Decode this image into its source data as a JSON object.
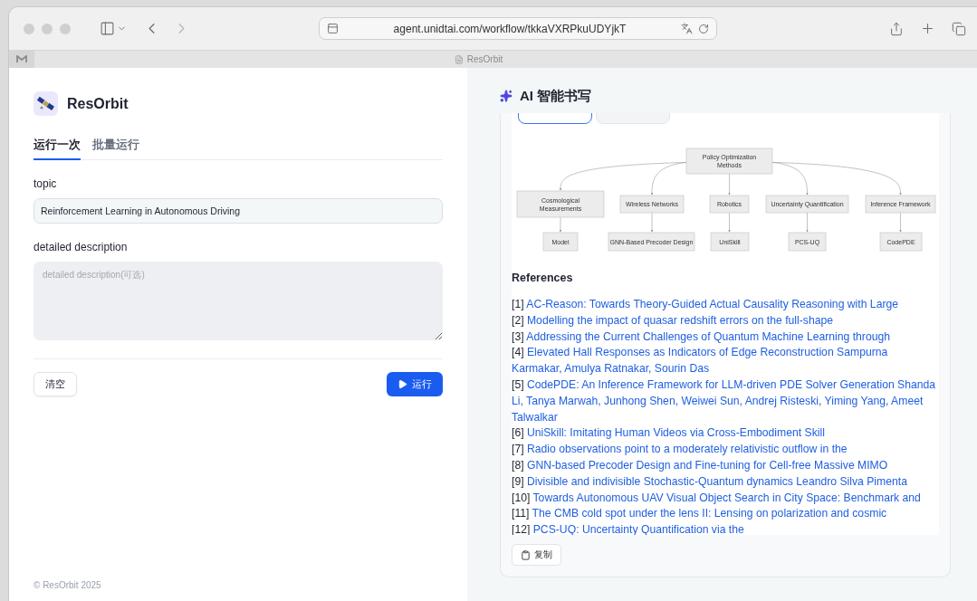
{
  "browser": {
    "url": "agent.unidtai.com/workflow/tkkaVXRPkuUDYjkT",
    "tab_title": "ResOrbit"
  },
  "app": {
    "name": "ResOrbit",
    "tabs": [
      {
        "label": "运行一次",
        "selected": true
      },
      {
        "label": "批量运行",
        "selected": false
      }
    ],
    "fields": [
      {
        "kind": "input",
        "label": "topic",
        "value": "Reinforcement Learning in Autonomous Driving"
      },
      {
        "kind": "textarea",
        "label": "detailed description",
        "placeholder": "detailed description(可选)"
      }
    ],
    "clear_button": "清空",
    "run_button": "运行",
    "footer": "© ResOrbit 2025"
  },
  "writer": {
    "title": "AI 智能书写",
    "view_tabs": [
      {
        "selected": true
      },
      {
        "selected": false
      }
    ],
    "diagram": {
      "root": [
        "Policy Optimization",
        "Methods"
      ],
      "branches": [
        {
          "label": [
            "Cosmological",
            "Measurements"
          ],
          "leaf": "Model"
        },
        {
          "label": [
            "Wireless Networks"
          ],
          "leaf": "GNN-Based Precoder Design"
        },
        {
          "label": [
            "Robotics"
          ],
          "leaf": "UniSkill"
        },
        {
          "label": [
            "Uncertainty Quantification"
          ],
          "leaf": "PCS-UQ"
        },
        {
          "label": [
            "Inference Framework"
          ],
          "leaf": "CodePDE"
        }
      ]
    },
    "references_heading": "References",
    "references": [
      {
        "number": "[1]",
        "title": "AC-Reason: Towards Theory-Guided Actual Causality Reasoning with Large"
      },
      {
        "number": "[2]",
        "title": "Modelling the impact of quasar redshift errors on the full-shape"
      },
      {
        "number": "[3]",
        "title": "Addressing the Current Challenges of Quantum Machine Learning through"
      },
      {
        "number": "[4]",
        "title": "Elevated Hall Responses as Indicators of Edge Reconstruction Sampurna Karmakar, Amulya Ratnakar, Sourin Das"
      },
      {
        "number": "[5]",
        "title": "CodePDE: An Inference Framework for LLM-driven PDE Solver Generation Shanda Li, Tanya Marwah, Junhong Shen, Weiwei Sun, Andrej Risteski, Yiming Yang, Ameet Talwalkar"
      },
      {
        "number": "[6]",
        "title": "UniSkill: Imitating Human Videos via Cross-Embodiment Skill"
      },
      {
        "number": "[7]",
        "title": "Radio observations point to a moderately relativistic outflow in the"
      },
      {
        "number": "[8]",
        "title": "GNN-based Precoder Design and Fine-tuning for Cell-free Massive MIMO"
      },
      {
        "number": "[9]",
        "title": "Divisible and indivisible Stochastic-Quantum dynamics Leandro Silva Pimenta"
      },
      {
        "number": "[10]",
        "title": "Towards Autonomous UAV Visual Object Search in City Space: Benchmark and"
      },
      {
        "number": "[11]",
        "title": "The CMB cold spot under the lens II: Lensing on polarization and cosmic"
      },
      {
        "number": "[12]",
        "title": "PCS-UQ: Uncertainty Quantification via the"
      }
    ],
    "copy_button": "复制"
  }
}
